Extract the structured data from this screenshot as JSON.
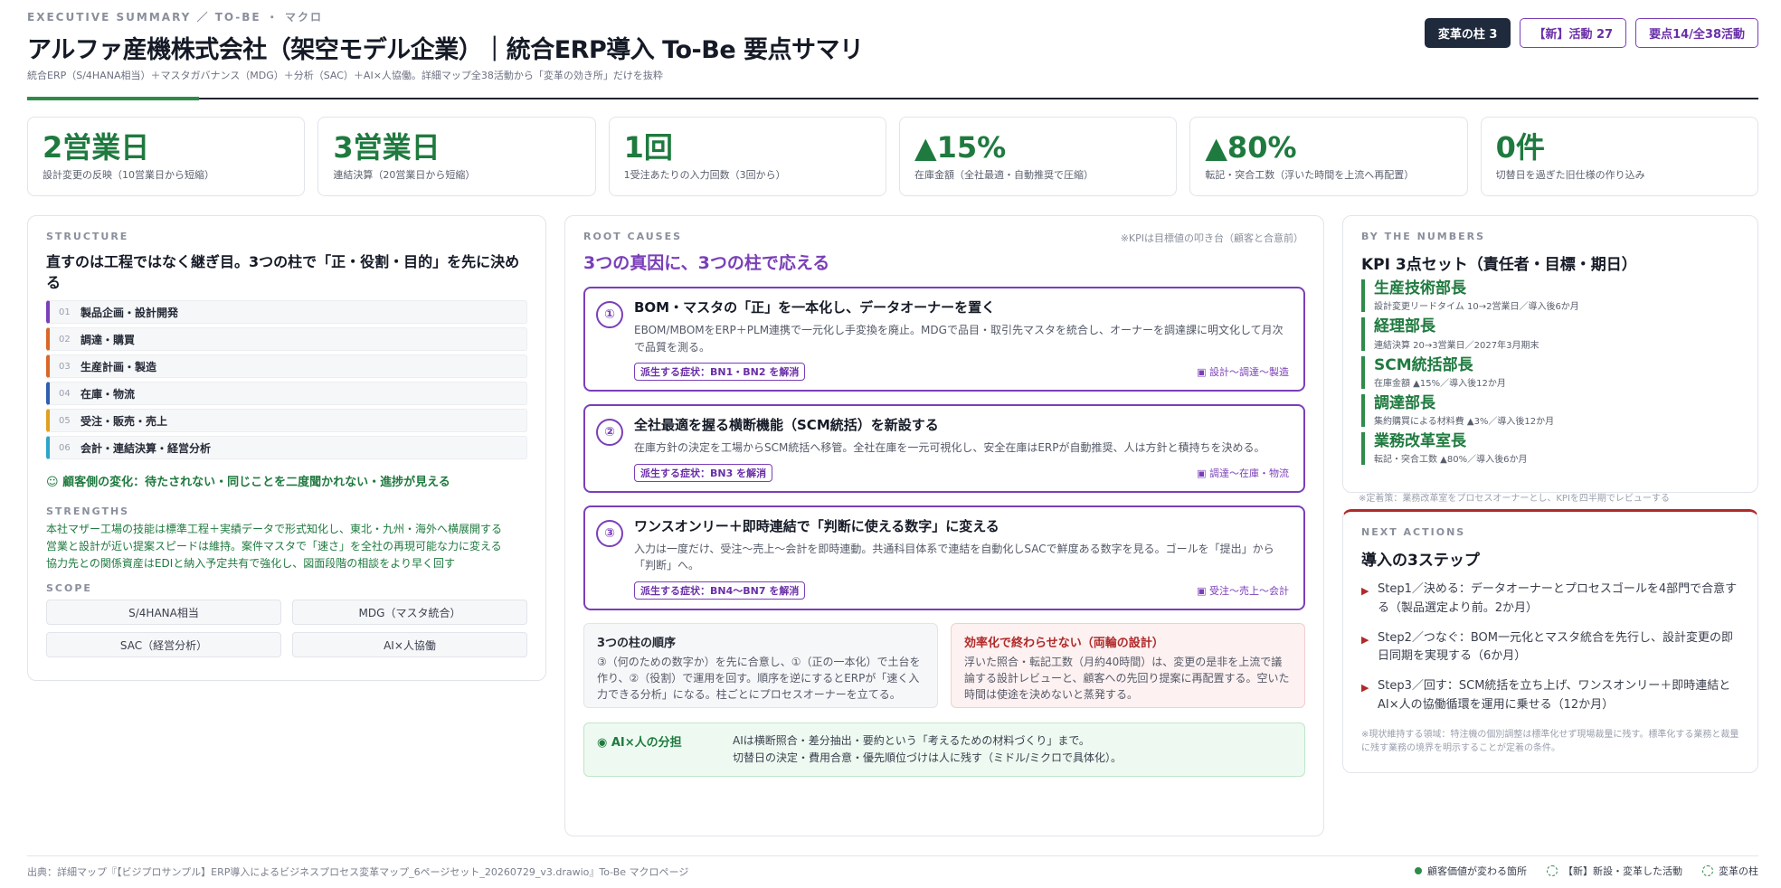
{
  "header": {
    "eyebrow": "EXECUTIVE SUMMARY ／ TO-BE ・ マクロ",
    "title": "アルファ産機株式会社（架空モデル企業）｜統合ERP導入 To-Be 要点サマリ",
    "subtitle": "統合ERP（S/4HANA相当）＋マスタガバナンス（MDG）＋分析（SAC）＋AI×人協働。詳細マップ全38活動から「変革の効き所」だけを抜粋",
    "badges": [
      "変革の柱 3",
      "【新】活動 27",
      "要点14/全38活動"
    ]
  },
  "kpis": [
    {
      "value": "2営業日",
      "label": "設計変更の反映（10営業日から短縮）"
    },
    {
      "value": "3営業日",
      "label": "連結決算（20営業日から短縮）"
    },
    {
      "value": "1回",
      "label": "1受注あたりの入力回数（3回から）"
    },
    {
      "value": "▲15%",
      "label": "在庫金額（全社最適・自動推奨で圧縮）"
    },
    {
      "value": "▲80%",
      "label": "転記・突合工数（浮いた時間を上流へ再配置）"
    },
    {
      "value": "0件",
      "label": "切替日を過ぎた旧仕様の作り込み"
    }
  ],
  "structure": {
    "label": "STRUCTURE",
    "heading": "直すのは工程ではなく継ぎ目。3つの柱で「正・役割・目的」を先に決める",
    "processes": [
      {
        "num": "01",
        "name": "製品企画・設計開発",
        "color": "#7a3fb8"
      },
      {
        "num": "02",
        "name": "調達・購買",
        "color": "#d9662a"
      },
      {
        "num": "03",
        "name": "生産計画・製造",
        "color": "#d9662a"
      },
      {
        "num": "04",
        "name": "在庫・物流",
        "color": "#2f5fb0"
      },
      {
        "num": "05",
        "name": "受注・販売・売上",
        "color": "#e0a020"
      },
      {
        "num": "06",
        "name": "会計・連結決算・経営分析",
        "color": "#2aa6c8"
      }
    ],
    "change": "☺ 顧客側の変化：待たされない・同じことを二度聞かれない・進捗が見える",
    "strengths_label": "STRENGTHS",
    "strengths": [
      "本社マザー工場の技能は標準工程＋実績データで形式知化し、東北・九州・海外へ横展開する",
      "営業と設計が近い提案スピードは維持。案件マスタで「速さ」を全社の再現可能な力に変える",
      "協力先との関係資産はEDIと納入予定共有で強化し、図面段階の相談をより早く回す"
    ],
    "scope_label": "SCOPE",
    "scope": [
      "S/4HANA相当",
      "MDG（マスタ統合）",
      "SAC（経営分析）",
      "AI×人協働"
    ]
  },
  "root_causes": {
    "label": "ROOT CAUSES",
    "note": "※KPIは目標値の叩き台（顧客と合意前）",
    "heading": "3つの真因に、3つの柱で応える",
    "pillars": [
      {
        "num": "①",
        "title": "BOM・マスタの「正」を一本化し、データオーナーを置く",
        "desc": "EBOM/MBOMをERP＋PLM連携で一元化し手変換を廃止。MDGで品目・取引先マスタを統合し、オーナーを調達課に明文化して月次で品質を測る。",
        "tag": "派生する症状：BN1・BN2 を解消",
        "path": "▣ 設計〜調達〜製造"
      },
      {
        "num": "②",
        "title": "全社最適を握る横断機能（SCM統括）を新設する",
        "desc": "在庫方針の決定を工場からSCM統括へ移管。全社在庫を一元可視化し、安全在庫はERPが自動推奨、人は方針と積持ちを決める。",
        "tag": "派生する症状：BN3 を解消",
        "path": "▣ 調達〜在庫・物流"
      },
      {
        "num": "③",
        "title": "ワンスオンリー＋即時連結で「判断に使える数字」に変える",
        "desc": "入力は一度だけ、受注〜売上〜会計を即時連動。共通科目体系で連結を自動化しSACで鮮度ある数字を見る。ゴールを「提出」から「判断」へ。",
        "tag": "派生する症状：BN4〜BN7 を解消",
        "path": "▣ 受注〜売上〜会計"
      }
    ],
    "order_title": "3つの柱の順序",
    "order_text": "③（何のための数字か）を先に合意し、①（正の一本化）で土台を作り、②（役割）で運用を回す。順序を逆にするとERPが「速く入力できる分析」になる。柱ごとにプロセスオーナーを立てる。",
    "warn_title": "効率化で終わらせない（両輪の設計）",
    "warn_text": "浮いた照合・転記工数（月約40時間）は、変更の是非を上流で議論する設計レビューと、顧客への先回り提案に再配置する。空いた時間は使途を決めないと蒸発する。",
    "ai_title": "◉ AI×人の分担",
    "ai_lines": [
      "AIは横断照合・差分抽出・要約という「考えるための材料づくり」まで。",
      "切替日の決定・費用合意・優先順位づけは人に残す（ミドル/ミクロで具体化）。"
    ]
  },
  "numbers": {
    "label": "BY THE NUMBERS",
    "heading": "KPI 3点セット（責任者・目標・期日）",
    "owners": [
      {
        "title": "生産技術部長",
        "detail": "設計変更リードタイム 10→2営業日／導入後6か月"
      },
      {
        "title": "経理部長",
        "detail": "連結決算 20→3営業日／2027年3月期末"
      },
      {
        "title": "SCM統括部長",
        "detail": "在庫金額 ▲15%／導入後12か月"
      },
      {
        "title": "調達部長",
        "detail": "集約購買による材料費 ▲3%／導入後12か月"
      },
      {
        "title": "業務改革室長",
        "detail": "転記・突合工数 ▲80%／導入後6か月"
      }
    ],
    "note": "※定着策：業務改革室をプロセスオーナーとし、KPIを四半期でレビューする"
  },
  "next_actions": {
    "label": "NEXT ACTIONS",
    "heading": "導入の3ステップ",
    "steps": [
      "Step1／決める：データオーナーとプロセスゴールを4部門で合意する（製品選定より前。2か月）",
      "Step2／つなぐ：BOM一元化とマスタ統合を先行し、設計変更の即日同期を実現する（6か月）",
      "Step3／回す：SCM統括を立ち上げ、ワンスオンリー＋即時連結とAI×人の協働循環を運用に乗せる（12か月）"
    ],
    "note": "※現状維持する領域：特注機の個別調整は標準化せず現場裁量に残す。標準化する業務と裁量に残す業務の境界を明示することが定着の条件。"
  },
  "footer": {
    "source": "出典：詳細マップ『【ビジプロサンプル】ERP導入によるビジネスプロセス変革マップ_6ページセット_20260729_v3.drawio』To-Be マクロページ",
    "legend": [
      "顧客価値が変わる箇所",
      "【新】新設・変革した活動",
      "変革の柱"
    ]
  },
  "colors": {
    "accent_green": "#1f7a3f",
    "accent_purple": "#7a3fb8",
    "accent_red": "#b02a2a"
  }
}
